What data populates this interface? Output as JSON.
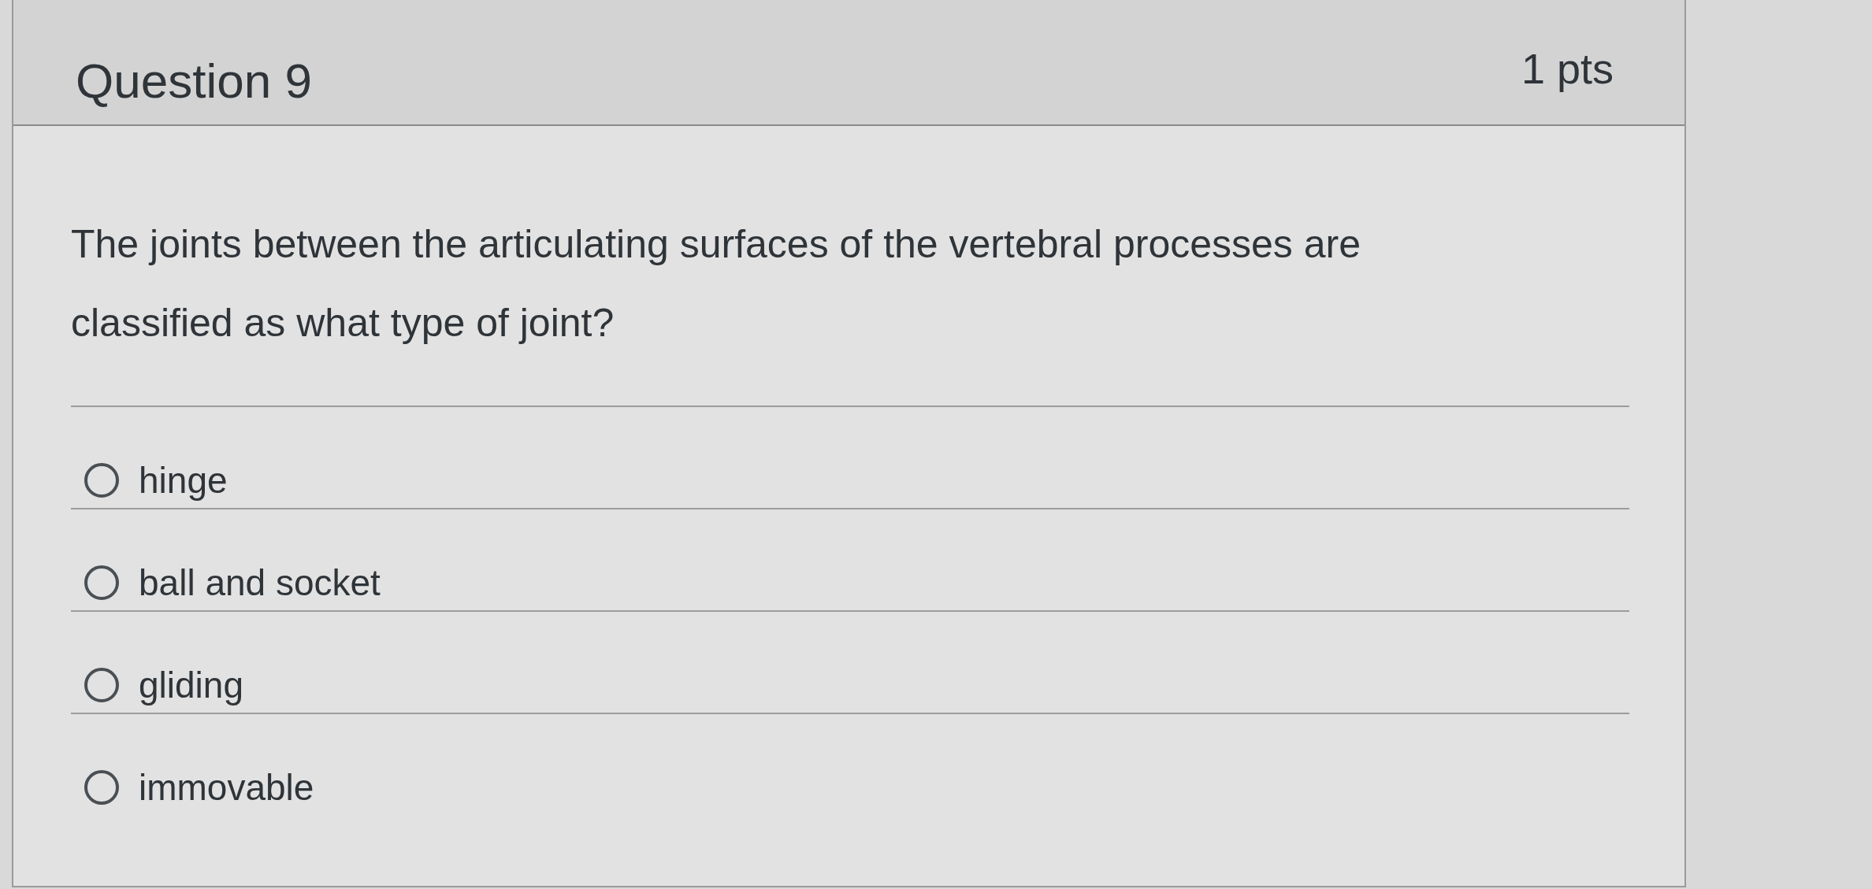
{
  "question": {
    "title": "Question 9",
    "points": "1 pts",
    "text": "The joints between the articulating surfaces of the vertebral processes are classified as what type of joint?"
  },
  "options": [
    {
      "label": "hinge",
      "selected": false
    },
    {
      "label": "ball and socket",
      "selected": false
    },
    {
      "label": "gliding",
      "selected": false
    },
    {
      "label": "immovable",
      "selected": false
    }
  ]
}
